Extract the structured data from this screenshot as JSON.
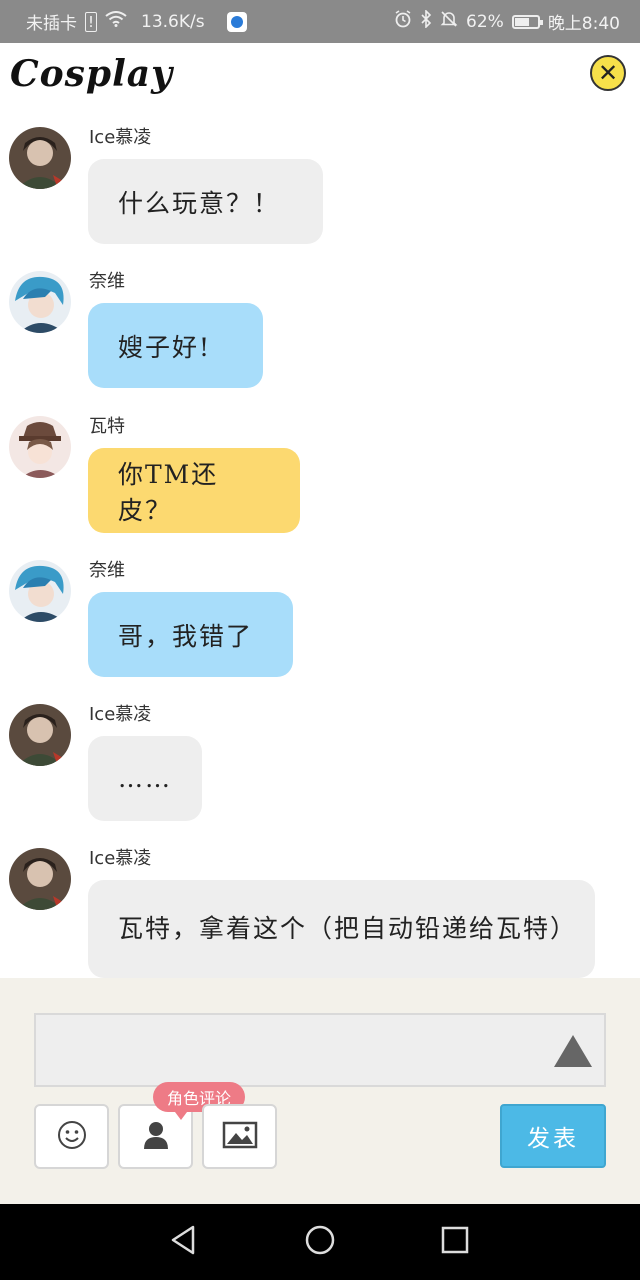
{
  "status_bar": {
    "carrier": "未插卡",
    "speed": "13.6K/s",
    "battery": "62%",
    "battery_level": 0.62,
    "time": "晚上8:40"
  },
  "header": {
    "title": "Cosplay",
    "close_icon": "close-circle-icon"
  },
  "messages": [
    {
      "user": "Ice慕凌",
      "text": "什么玩意？！",
      "color": "gray",
      "avatar": "avatar-dark-hair"
    },
    {
      "user": "奈维",
      "text": "嫂子好!",
      "color": "blue",
      "avatar": "avatar-blue-hair"
    },
    {
      "user": "瓦特",
      "text": "你TM还皮？",
      "color": "yellow",
      "avatar": "avatar-hat"
    },
    {
      "user": "奈维",
      "text": "哥，我错了",
      "color": "blue",
      "avatar": "avatar-blue-hair"
    },
    {
      "user": "Ice慕凌",
      "text": "……",
      "color": "gray",
      "avatar": "avatar-dark-hair"
    },
    {
      "user": "Ice慕凌",
      "text": "瓦特，拿着这个（把自动铅递给瓦特）",
      "color": "gray",
      "avatar": "avatar-dark-hair"
    }
  ],
  "composer": {
    "input_value": "",
    "role_comment_tag": "角色评论",
    "post_label": "发表"
  },
  "colors": {
    "bubble_gray": "#eeeeee",
    "bubble_blue": "#a8ddfa",
    "bubble_yellow": "#fcd970",
    "post_button": "#4cb9e6",
    "tag": "#ee7b86"
  }
}
